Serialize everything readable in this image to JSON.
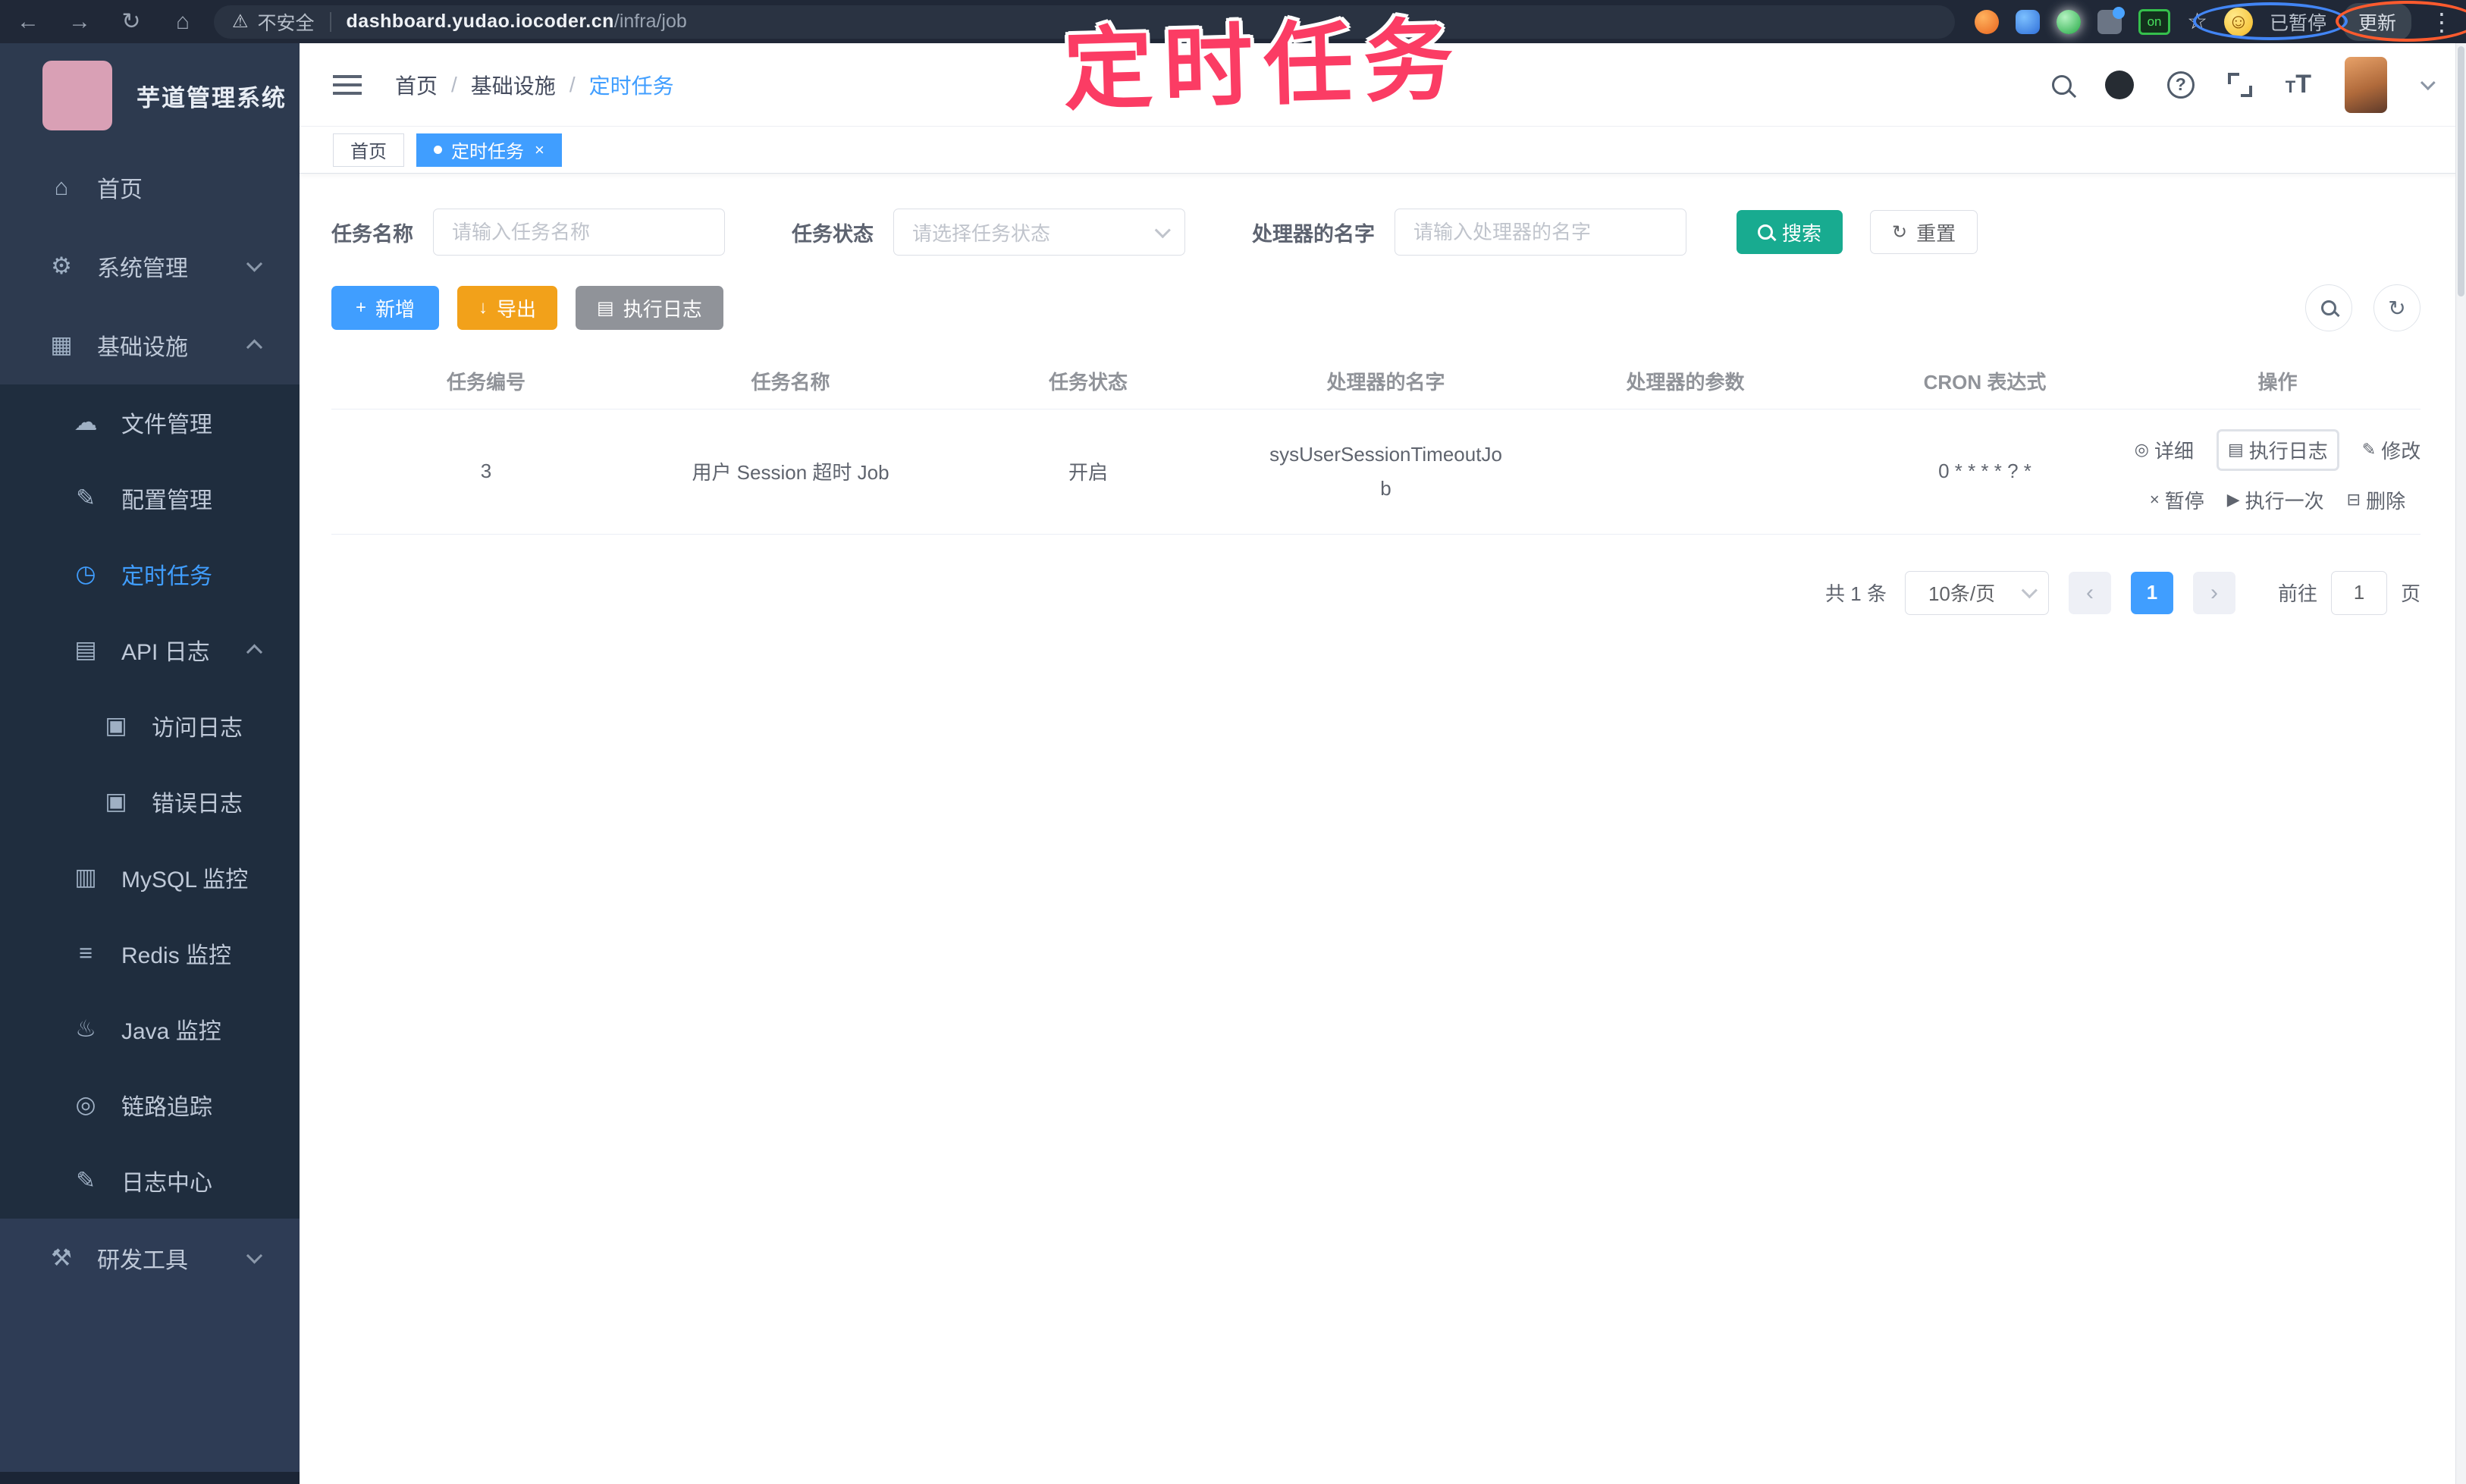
{
  "browser": {
    "security_label": "不安全",
    "url_domain": "dashboard.yudao.iocoder.cn",
    "url_path": "/infra/job",
    "ext_on_badge": "on",
    "profile_paused": "已暂停",
    "update_label": "更新"
  },
  "annotation": {
    "title": "定时任务"
  },
  "sidebar": {
    "app_title": "芋道管理系统",
    "items": [
      {
        "label": "首页"
      },
      {
        "label": "系统管理"
      },
      {
        "label": "基础设施"
      },
      {
        "label": "文件管理"
      },
      {
        "label": "配置管理"
      },
      {
        "label": "定时任务"
      },
      {
        "label": "API 日志"
      },
      {
        "label": "访问日志"
      },
      {
        "label": "错误日志"
      },
      {
        "label": "MySQL 监控"
      },
      {
        "label": "Redis 监控"
      },
      {
        "label": "Java 监控"
      },
      {
        "label": "链路追踪"
      },
      {
        "label": "日志中心"
      },
      {
        "label": "研发工具"
      }
    ]
  },
  "navbar": {
    "breadcrumb": [
      "首页",
      "基础设施",
      "定时任务"
    ],
    "separator": "/"
  },
  "tabs": {
    "home": "首页",
    "active": "定时任务"
  },
  "filters": {
    "name_label": "任务名称",
    "name_placeholder": "请输入任务名称",
    "status_label": "任务状态",
    "status_placeholder": "请选择任务状态",
    "handler_label": "处理器的名字",
    "handler_placeholder": "请输入处理器的名字",
    "search_label": "搜索",
    "reset_label": "重置"
  },
  "toolbar": {
    "add_label": "新增",
    "export_label": "导出",
    "job_log_label": "执行日志"
  },
  "table": {
    "columns": [
      "任务编号",
      "任务名称",
      "任务状态",
      "处理器的名字",
      "处理器的参数",
      "CRON 表达式",
      "操作"
    ],
    "row": {
      "id": "3",
      "name": "用户 Session 超时 Job",
      "status": "开启",
      "handler": "sysUserSessionTimeoutJob",
      "param": "",
      "cron": "0 * * * * ? *"
    },
    "ops": {
      "detail": "详细",
      "log": "执行日志",
      "modify": "修改",
      "pause": "暂停",
      "run_once": "执行一次",
      "delete": "删除"
    }
  },
  "pagination": {
    "total": "共 1 条",
    "page_size": "10条/页",
    "page": "1",
    "goto_label": "前往",
    "goto_value": "1",
    "page_unit": "页"
  },
  "icons": {
    "back": "←",
    "forward": "→",
    "reload": "↻",
    "home": "⌂",
    "warning": "⚠",
    "star": "☆",
    "smile": "☺",
    "dots": "⋮",
    "close": "×",
    "question": "?",
    "menu_home": "⌂",
    "gear": "⚙",
    "infra": "▦",
    "cloud": "☁",
    "edit": "✎",
    "timer": "◷",
    "api": "▤",
    "doc": "▣",
    "mysql": "▥",
    "redis": "≡",
    "java": "♨",
    "trace": "◎",
    "log_center": "✎",
    "toolbox": "⚒",
    "plus": "+",
    "download": "↓",
    "list": "▤",
    "refresh": "↻",
    "op_detail": "◎",
    "op_modify": "✎",
    "op_pause": "×",
    "op_run": "▶",
    "op_delete": "⊟",
    "prev": "‹",
    "next": "›",
    "t_small": "T",
    "t_big": "T"
  }
}
